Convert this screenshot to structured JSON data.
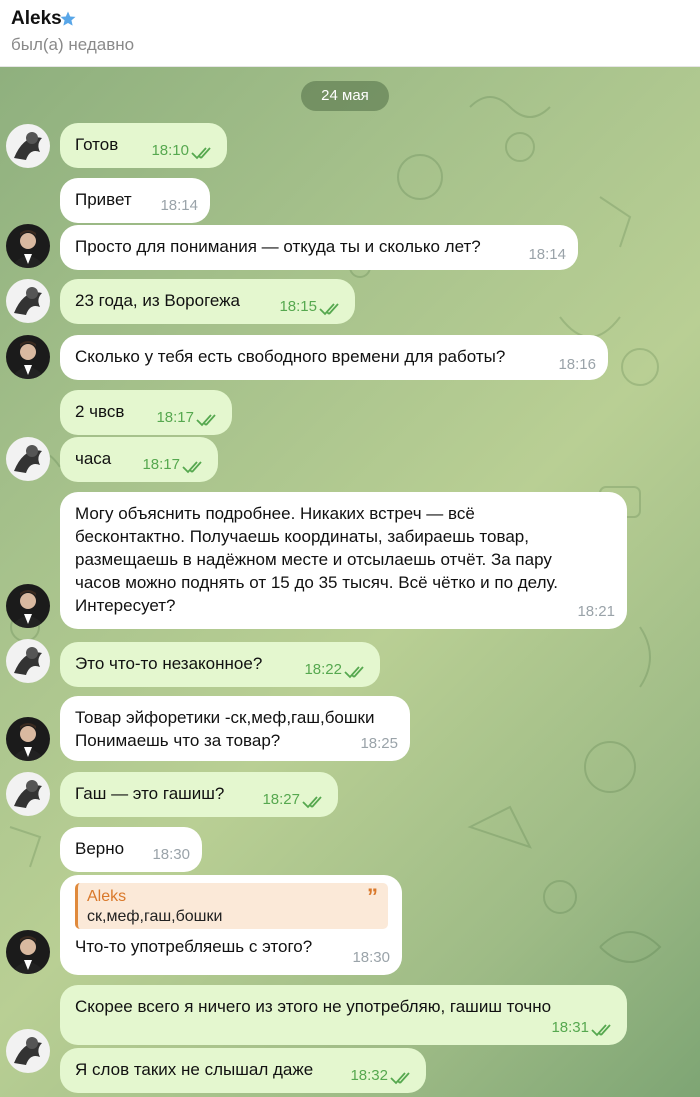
{
  "header": {
    "name": "Aleks",
    "status": "был(а) недавно",
    "star_icon": "star-icon",
    "star_color": "#58a6e8"
  },
  "chat": {
    "date": "24 мая",
    "messages": [
      {
        "dir": "out",
        "text": "Готов",
        "time": "18:10"
      },
      {
        "dir": "in",
        "text": "Привет",
        "time": "18:14"
      },
      {
        "dir": "in",
        "text": "Просто для понимания — откуда ты и сколько лет?",
        "time": "18:14"
      },
      {
        "dir": "out",
        "text": "23 года, из Ворогежа",
        "time": "18:15"
      },
      {
        "dir": "in",
        "text": "Сколько у тебя есть свободного времени для работы?",
        "time": "18:16"
      },
      {
        "dir": "out",
        "text": "2 чвсв",
        "time": "18:17"
      },
      {
        "dir": "out",
        "text": "часа",
        "time": "18:17"
      },
      {
        "dir": "in",
        "text_lines": [
          "Могу объяснить подробнее. Никаких встреч — всё",
          "бесконтактно. Получаешь координаты, забираешь товар,",
          "размещаешь в надёжном месте и отсылаешь отчёт. За пару",
          "часов можно поднять от 15 до 35 тысяч. Всё чётко и по делу.",
          "Интересует?"
        ],
        "time": "18:21"
      },
      {
        "dir": "out",
        "text": "Это что-то незаконное?",
        "time": "18:22"
      },
      {
        "dir": "in",
        "text_lines": [
          "Товар эйфоретики -ск,меф,гаш,бошки",
          "Понимаешь что за товар?"
        ],
        "time": "18:25"
      },
      {
        "dir": "out",
        "text": "Гаш — это гашиш?",
        "time": "18:27"
      },
      {
        "dir": "in",
        "text": "Верно",
        "time": "18:30"
      },
      {
        "dir": "in",
        "reply_name": "Aleks",
        "reply_text": "ск,меф,гаш,бошки",
        "text": "Что-то употребляешь с этого?",
        "time": "18:30"
      },
      {
        "dir": "out",
        "text": "Скорее всего я ничего из этого не употребляю, гашиш точно",
        "time": "18:31"
      },
      {
        "dir": "out",
        "text": "Я слов таких не слышал даже",
        "time": "18:32"
      }
    ]
  },
  "colors": {
    "outgoing_bubble": "#e4f7cf",
    "incoming_bubble": "#ffffff",
    "read_ticks": "#56a84f",
    "reply_accent": "#e08a3c"
  }
}
